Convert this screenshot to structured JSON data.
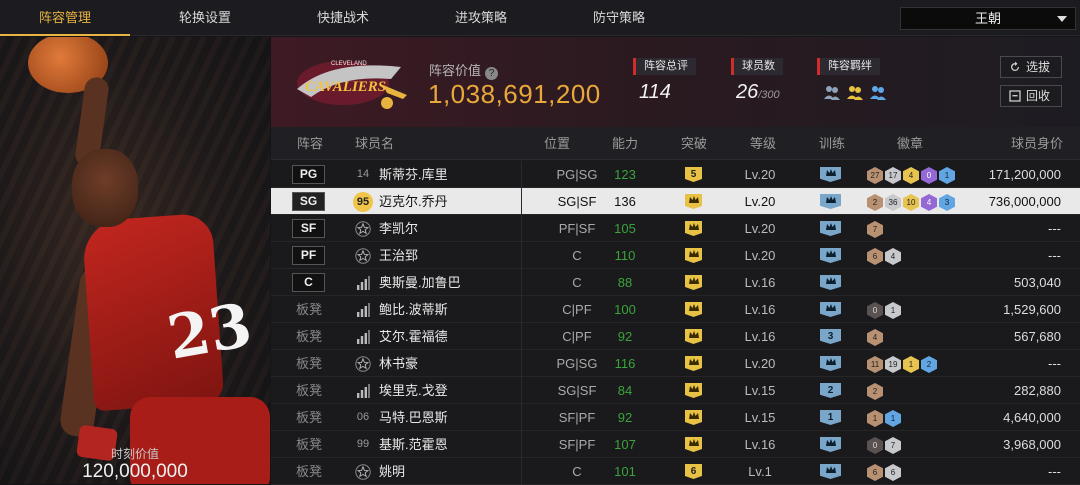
{
  "tabs": [
    {
      "label": "阵容管理",
      "active": true
    },
    {
      "label": "轮换设置",
      "active": false
    },
    {
      "label": "快捷战术",
      "active": false
    },
    {
      "label": "进攻策略",
      "active": false
    },
    {
      "label": "防守策略",
      "active": false
    }
  ],
  "team_select": {
    "value": "王朝"
  },
  "player_panel": {
    "moment_label": "时刻价值",
    "moment_value": "120,000,000",
    "jersey_number": "23"
  },
  "header": {
    "team_logo_text": "CAVALIERS",
    "team_logo_sub": "CLEVELAND",
    "value_label": "阵容价值",
    "value": "1,038,691,200",
    "overall_label": "阵容总评",
    "overall_value": "114",
    "count_label": "球员数",
    "count_value": "26",
    "count_max": "/300",
    "bond_label": "阵容羁绊",
    "draft_button": "选拔",
    "recycle_button": "回收"
  },
  "columns": [
    "阵容",
    "球员名",
    "位置",
    "能力",
    "突破",
    "等级",
    "训练",
    "徽章",
    "球员身价"
  ],
  "rows": [
    {
      "slot": "PG",
      "bench": false,
      "jersey": "14",
      "jersey_type": "number",
      "name": "斯蒂芬.库里",
      "position": "PG|SG",
      "ability": "123",
      "breakthrough": "5",
      "level": "Lv.20",
      "training": "",
      "badges": [
        [
          "27",
          "bronze"
        ],
        [
          "17",
          "silver"
        ],
        [
          "4",
          "gold"
        ],
        [
          "0",
          "purple"
        ],
        [
          "1",
          "blue"
        ]
      ],
      "value": "171,200,000",
      "selected": false
    },
    {
      "slot": "SG",
      "bench": false,
      "jersey": "95",
      "jersey_type": "badge",
      "name": "迈克尔.乔丹",
      "position": "SG|SF",
      "ability": "136",
      "breakthrough": "crown",
      "level": "Lv.20",
      "training": "",
      "badges": [
        [
          "2",
          "bronze"
        ],
        [
          "36",
          "silver"
        ],
        [
          "10",
          "gold"
        ],
        [
          "4",
          "purple"
        ],
        [
          "3",
          "blue"
        ]
      ],
      "value": "736,000,000",
      "selected": true
    },
    {
      "slot": "SF",
      "bench": false,
      "jersey": "",
      "jersey_type": "star",
      "name": "李凯尔",
      "position": "PF|SF",
      "ability": "105",
      "breakthrough": "crown",
      "level": "Lv.20",
      "training": "",
      "badges": [
        [
          "7",
          "bronze"
        ]
      ],
      "value": "---",
      "selected": false
    },
    {
      "slot": "PF",
      "bench": false,
      "jersey": "",
      "jersey_type": "star",
      "name": "王治郅",
      "position": "C",
      "ability": "110",
      "breakthrough": "crown",
      "level": "Lv.20",
      "training": "",
      "badges": [
        [
          "6",
          "bronze"
        ],
        [
          "4",
          "silver"
        ]
      ],
      "value": "---",
      "selected": false
    },
    {
      "slot": "C",
      "bench": false,
      "jersey": "",
      "jersey_type": "bars",
      "name": "奥斯曼.加鲁巴",
      "position": "C",
      "ability": "88",
      "breakthrough": "crown",
      "level": "Lv.16",
      "training": "",
      "badges": [],
      "value": "503,040",
      "selected": false
    },
    {
      "slot": "板凳",
      "bench": true,
      "jersey": "",
      "jersey_type": "bars",
      "name": "鲍比.波蒂斯",
      "position": "C|PF",
      "ability": "100",
      "breakthrough": "crown",
      "level": "Lv.16",
      "training": "",
      "badges": [
        [
          "0",
          "dark"
        ],
        [
          "1",
          "silver"
        ]
      ],
      "value": "1,529,600",
      "selected": false
    },
    {
      "slot": "板凳",
      "bench": true,
      "jersey": "",
      "jersey_type": "bars",
      "name": "艾尔.霍福德",
      "position": "C|PF",
      "ability": "92",
      "breakthrough": "crown",
      "level": "Lv.16",
      "training": "3",
      "badges": [
        [
          "4",
          "bronze"
        ]
      ],
      "value": "567,680",
      "selected": false
    },
    {
      "slot": "板凳",
      "bench": true,
      "jersey": "",
      "jersey_type": "star",
      "name": "林书豪",
      "position": "PG|SG",
      "ability": "116",
      "breakthrough": "crown",
      "level": "Lv.20",
      "training": "",
      "badges": [
        [
          "11",
          "bronze"
        ],
        [
          "19",
          "silver"
        ],
        [
          "1",
          "gold"
        ],
        [
          "2",
          "blue"
        ]
      ],
      "value": "---",
      "selected": false
    },
    {
      "slot": "板凳",
      "bench": true,
      "jersey": "",
      "jersey_type": "bars",
      "name": "埃里克.戈登",
      "position": "SG|SF",
      "ability": "84",
      "breakthrough": "crown",
      "level": "Lv.15",
      "training": "2",
      "badges": [
        [
          "2",
          "bronze"
        ]
      ],
      "value": "282,880",
      "selected": false
    },
    {
      "slot": "板凳",
      "bench": true,
      "jersey": "06",
      "jersey_type": "number",
      "name": "马特.巴恩斯",
      "position": "SF|PF",
      "ability": "92",
      "breakthrough": "crown",
      "level": "Lv.15",
      "training": "1",
      "badges": [
        [
          "1",
          "bronze"
        ],
        [
          "1",
          "blue"
        ]
      ],
      "value": "4,640,000",
      "selected": false
    },
    {
      "slot": "板凳",
      "bench": true,
      "jersey": "99",
      "jersey_type": "number",
      "name": "基斯.范霍恩",
      "position": "SF|PF",
      "ability": "107",
      "breakthrough": "crown",
      "level": "Lv.16",
      "training": "",
      "badges": [
        [
          "0",
          "dark"
        ],
        [
          "7",
          "silver"
        ]
      ],
      "value": "3,968,000",
      "selected": false
    },
    {
      "slot": "板凳",
      "bench": true,
      "jersey": "",
      "jersey_type": "star",
      "name": "姚明",
      "position": "C",
      "ability": "101",
      "breakthrough": "6",
      "level": "Lv.1",
      "training": "",
      "badges": [
        [
          "6",
          "bronze"
        ],
        [
          "6",
          "silver"
        ]
      ],
      "value": "---",
      "selected": false
    }
  ],
  "colors": {
    "accent": "#e9b441",
    "value_gold": "#e8a83a",
    "ability_green": "#3aa33a",
    "stat_red": "#d12b2b"
  }
}
